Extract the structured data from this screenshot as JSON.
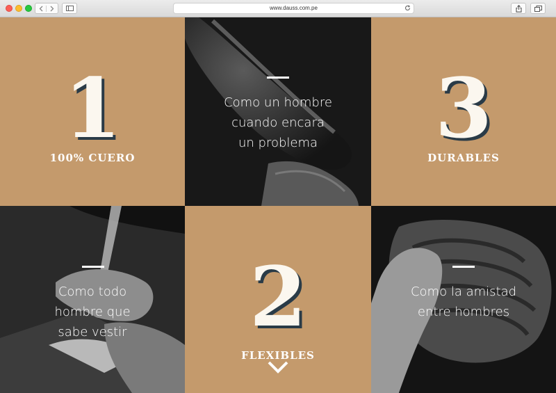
{
  "browser": {
    "url": "www.dauss.com.pe"
  },
  "tiles": {
    "t1": {
      "number": "1",
      "label": "100% CUERO"
    },
    "t2": {
      "quote": [
        "Como un hombre",
        "cuando encara",
        "un problema"
      ]
    },
    "t3": {
      "number": "3",
      "label": "DURABLES"
    },
    "t4": {
      "quote": [
        "Como todo",
        "hombre que",
        "sabe vestir"
      ]
    },
    "t5": {
      "number": "2",
      "label": "FLEXIBLES"
    },
    "t6": {
      "quote": [
        "Como la amistad",
        "entre hombres"
      ]
    }
  },
  "colors": {
    "tan": "#c49a6c",
    "number_shadow": "#2a3b47",
    "photo_dark": "#1b1b1b"
  },
  "icons": [
    "back-icon",
    "forward-icon",
    "sidebar-icon",
    "reload-icon",
    "share-icon",
    "tabs-icon",
    "chevron-down-icon"
  ]
}
